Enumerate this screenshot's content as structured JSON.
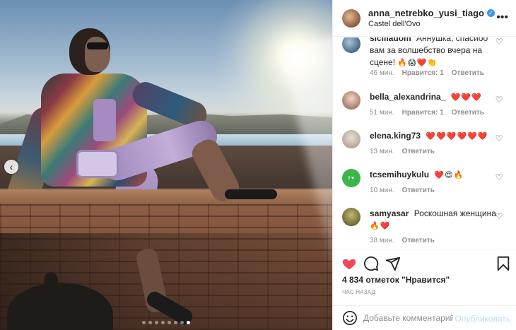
{
  "post": {
    "username": "anna_netrebko_yusi_tiago",
    "location": "Castel dell'Ovo",
    "carousel_dots": 8,
    "carousel_active": 7
  },
  "comments": [
    {
      "username": "sicilladom",
      "text": "Аннушка, спасибо вам за волшебство вчера на сцене!",
      "emoji": "🔥😱❤️👏",
      "time": "46 мин.",
      "likes_label": "Нравится: 1",
      "reply": "Ответить"
    },
    {
      "username": "bella_alexandrina_",
      "text": "",
      "emoji": "❤️❤️❤️",
      "time": "51 мин.",
      "likes_label": "Нравится: 1",
      "reply": "Ответить"
    },
    {
      "username": "elena.king73",
      "text": "",
      "emoji": "❤️❤️❤️❤️❤️❤️",
      "time": "13 мин.",
      "likes_label": "",
      "reply": "Ответить"
    },
    {
      "username": "tcsemihuykulu",
      "text": "",
      "emoji": "❤️😍🔥",
      "time": "10 мин.",
      "likes_label": "",
      "reply": "Ответить"
    },
    {
      "username": "samyasar",
      "text": "Роскошная женщина",
      "emoji": "🔥❤️",
      "time": "38 мин.",
      "likes_label": "",
      "reply": "Ответить"
    }
  ],
  "likes_text": "4 834 отметок \"Нравится\"",
  "timestamp": "ЧАС НАЗАД",
  "comment_input": {
    "placeholder": "Добавьте комментарий...",
    "value": ""
  },
  "publish_label": "Опубликовать",
  "colors": {
    "verified": "#3897f0",
    "liked": "#ed4956",
    "publish_disabled": "#b2dffc",
    "muted": "#8e8e8e"
  }
}
